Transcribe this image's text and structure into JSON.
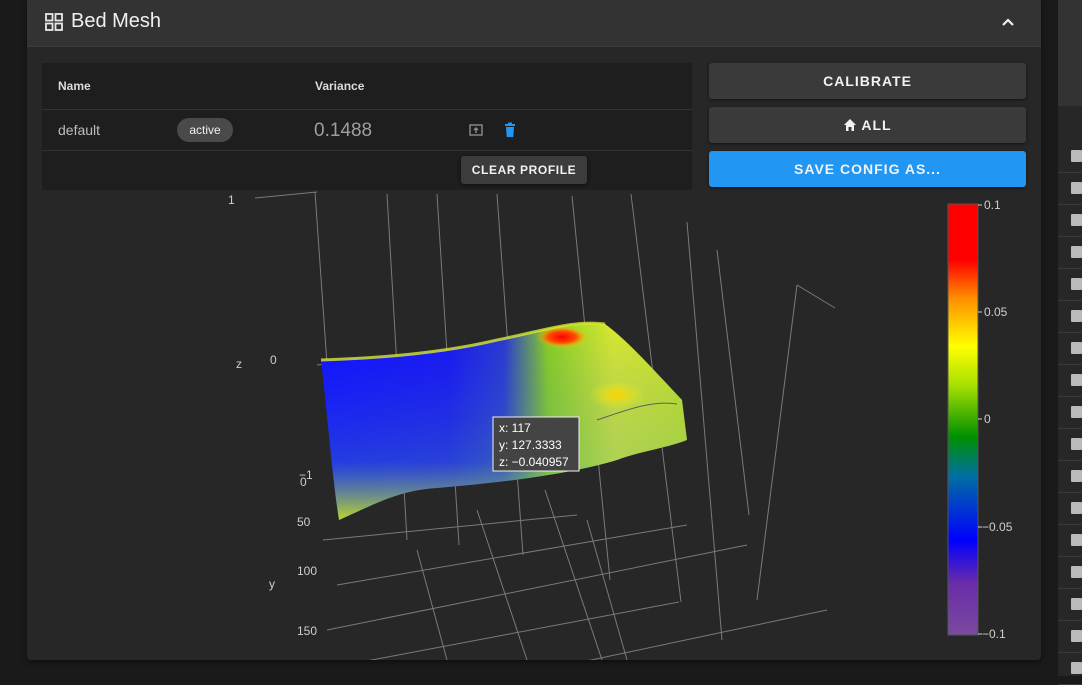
{
  "card": {
    "title": "Bed Mesh",
    "title_icon": "grid-icon",
    "collapse_icon": "chevron-up-icon"
  },
  "table": {
    "headers": {
      "name": "Name",
      "variance": "Variance"
    },
    "rows": [
      {
        "name": "default",
        "badge": "active",
        "variance": "0.1488"
      }
    ],
    "clear_label": "CLEAR PROFILE"
  },
  "actions": {
    "calibrate": "CALIBRATE",
    "home_all": "ALL",
    "home_icon": "home-icon",
    "save_config": "SAVE CONFIG AS..."
  },
  "colors": {
    "accent": "#2196f3",
    "card": "#272727",
    "header": "#333333"
  },
  "chart_data": {
    "type": "surface3d",
    "axes": {
      "x": {
        "label": "",
        "ticks": []
      },
      "y": {
        "label": "y",
        "ticks": [
          "0",
          "50",
          "100",
          "150"
        ]
      },
      "z": {
        "label": "z",
        "ticks": [
          "−1",
          "0",
          "1"
        ]
      }
    },
    "colorbar": {
      "ticks": [
        "0.1",
        "0.05",
        "0",
        "−0.05",
        "−0.1"
      ],
      "range": [
        -0.1,
        0.1
      ],
      "colors": [
        "#ff0000",
        "#ff8800",
        "#ffff00",
        "#a0e000",
        "#00a000",
        "#0070a0",
        "#0000ff",
        "#7a3ca0"
      ]
    },
    "tooltip": {
      "x": "x: 117",
      "y": "y: 127.3333",
      "z": "z: −0.040957"
    }
  }
}
